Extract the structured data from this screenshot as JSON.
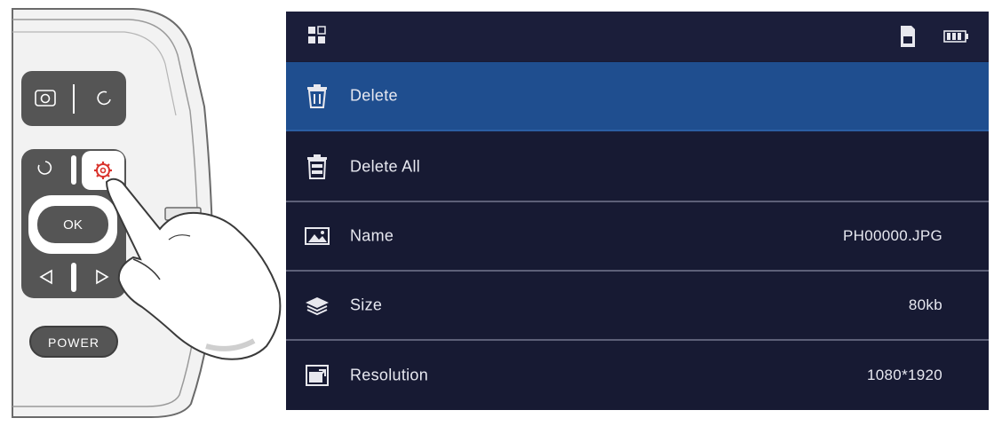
{
  "device": {
    "power_label": "POWER",
    "ok_label": "OK"
  },
  "screen": {
    "topbar": {
      "left_icon": "grid-icon",
      "right_icons": [
        "sd-card-icon",
        "battery-icon"
      ]
    },
    "menu": [
      {
        "label": "Delete",
        "value": "",
        "icon": "trash-icon",
        "selected": true
      },
      {
        "label": "Delete All",
        "value": "",
        "icon": "trash-all-icon",
        "selected": false
      },
      {
        "label": "Name",
        "value": "PH00000.JPG",
        "icon": "image-icon",
        "selected": false
      },
      {
        "label": "Size",
        "value": "80kb",
        "icon": "layers-icon",
        "selected": false
      },
      {
        "label": "Resolution",
        "value": "1080*1920",
        "icon": "resolution-icon",
        "selected": false
      }
    ]
  },
  "colors": {
    "selected_row": "#1f4e8f",
    "background": "#181b36",
    "settings_icon": "#d9322b"
  }
}
